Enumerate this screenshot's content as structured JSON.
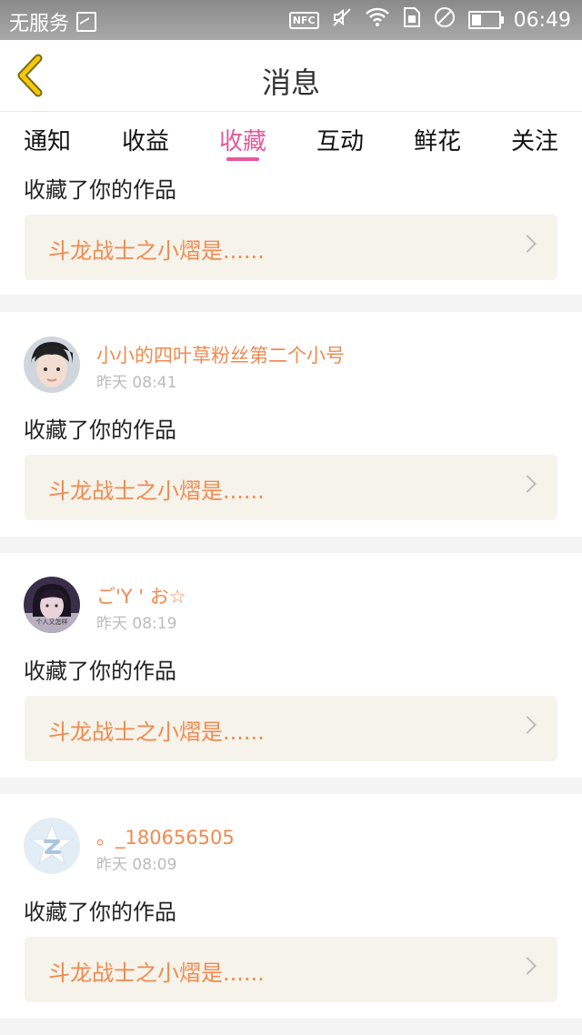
{
  "status_bar": {
    "carrier": "无服务",
    "nfc": "NFC",
    "time": "06:49"
  },
  "header": {
    "title": "消息"
  },
  "tabs": [
    {
      "label": "通知"
    },
    {
      "label": "收益"
    },
    {
      "label": "收藏",
      "active": true
    },
    {
      "label": "互动"
    },
    {
      "label": "鲜花"
    },
    {
      "label": "关注"
    }
  ],
  "notifications": [
    {
      "action": "收藏了你的作品",
      "work": "斗龙战士之小熠是......"
    },
    {
      "user": "小小的四叶草粉丝第二个小号",
      "time": "昨天 08:41",
      "action": "收藏了你的作品",
      "work": "斗龙战士之小熠是......"
    },
    {
      "user": "ご'Y ' お☆",
      "time": "昨天 08:19",
      "action": "收藏了你的作品",
      "work": "斗龙战士之小熠是......",
      "avatar_caption": "个人又怎样"
    },
    {
      "user": "。_180656505",
      "time": "昨天 08:09",
      "action": "收藏了你的作品",
      "work": "斗龙战士之小熠是......"
    }
  ],
  "colors": {
    "accent": "#e5589a",
    "username": "#f08a50",
    "back_arrow": "#f4c90a"
  }
}
